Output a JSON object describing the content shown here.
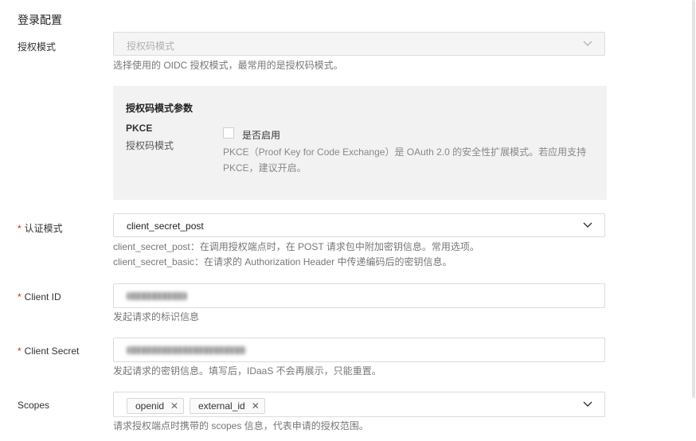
{
  "section_title": "登录配置",
  "grant_mode": {
    "label": "授权模式",
    "value": "授权码模式",
    "help": "选择使用的 OIDC 授权模式，最常用的是授权码模式。"
  },
  "auth_code_params": {
    "title": "授权码模式参数",
    "pkce_label": "PKCE",
    "pkce_sublabel": "授权码模式",
    "enable_label": "是否启用",
    "enabled": false,
    "help_line1": "PKCE（Proof Key for Code Exchange）是 OAuth 2.0 的安全性扩展模式。若应用支持",
    "help_line2": "PKCE，建议开启。"
  },
  "auth_method": {
    "required_mark": "*",
    "label": "认证模式",
    "value": "client_secret_post",
    "help_line1": "client_secret_post：在调用授权端点时，在 POST 请求包中附加密钥信息。常用选项。",
    "help_line2": "client_secret_basic：在请求的 Authorization Header 中传递编码后的密钥信息。"
  },
  "client_id": {
    "required_mark": "*",
    "label": "Client ID",
    "help": "发起请求的标识信息"
  },
  "client_secret": {
    "required_mark": "*",
    "label": "Client Secret",
    "help": "发起请求的密钥信息。填写后，IDaaS 不会再展示，只能重置。"
  },
  "scopes": {
    "label": "Scopes",
    "tags": [
      "openid",
      "external_id"
    ],
    "remove_glyph": "✕",
    "help": "请求授权端点时携带的 scopes 信息，代表申请的授权范围。"
  },
  "icons": {
    "dropdown": "chevron-down-icon",
    "remove": "close-icon"
  }
}
